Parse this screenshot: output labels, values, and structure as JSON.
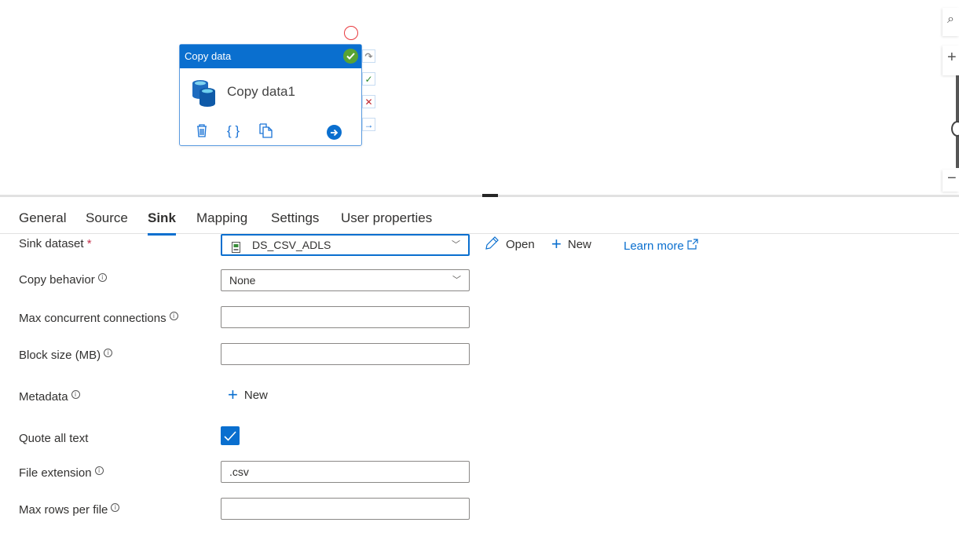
{
  "canvas": {
    "activity": {
      "type_label": "Copy data",
      "name": "Copy data1",
      "status": "succeeded",
      "tools": [
        "delete-icon",
        "code-icon",
        "clone-icon",
        "navigate-icon"
      ]
    },
    "ports": [
      "skip",
      "success",
      "failure",
      "completion"
    ],
    "zoom_controls": [
      "search-icon",
      "zoom-in-icon",
      "zoom-slider",
      "zoom-out-icon"
    ]
  },
  "tabs": [
    {
      "label": "General"
    },
    {
      "label": "Source"
    },
    {
      "label": "Sink",
      "active": true
    },
    {
      "label": "Mapping"
    },
    {
      "label": "Settings"
    },
    {
      "label": "User properties"
    }
  ],
  "form": {
    "sink_dataset": {
      "label": "Sink dataset",
      "required": "*",
      "value": "DS_CSV_ADLS",
      "open_label": "Open",
      "new_label": "New",
      "learn_more": "Learn more"
    },
    "copy_behavior": {
      "label": "Copy behavior",
      "value": "None"
    },
    "max_concurrent_connections": {
      "label": "Max concurrent connections",
      "value": ""
    },
    "block_size": {
      "label": "Block size (MB)",
      "value": ""
    },
    "metadata": {
      "label": "Metadata",
      "new_label": "New"
    },
    "quote_all_text": {
      "label": "Quote all text",
      "checked": true
    },
    "file_extension": {
      "label": "File extension",
      "value": ".csv"
    },
    "max_rows_per_file": {
      "label": "Max rows per file",
      "value": ""
    }
  },
  "colors": {
    "accent": "#0a6fcf",
    "success": "#58a333",
    "error": "#c0262d",
    "required": "#c4314b"
  }
}
